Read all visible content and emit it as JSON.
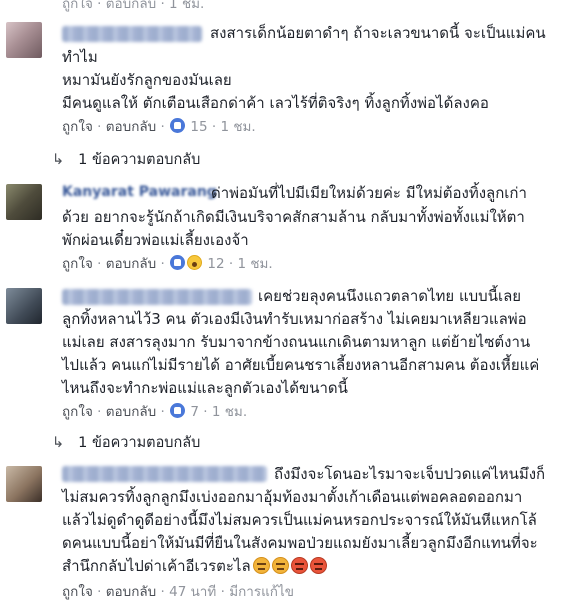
{
  "clipped_top": {
    "text": "ถูกใจ · ตอบกลับ · 1 ชม."
  },
  "comments": [
    {
      "text_lines": [
        "สงสารเด็กน้อยตาดำๆ ถ้าจะเลวขนาดนี้ จะเป็นแม่คน",
        "ทำไม",
        "หมามันยังรักลูกของมันเลย",
        "มีคนดูแลให้ ตักเตือนเสือกด่าค้า เลวไร้ที่ติจริงๆ ทิ้งลูกทิ้งพ่อได้ลงคอ"
      ],
      "like_label": "ถูกใจ",
      "reply_label": "ตอบกลับ",
      "reaction_count": "15",
      "time": "1 ชม.",
      "replies_label": "1 ข้อความตอบกลับ"
    },
    {
      "author": "Kanyarat Pawarang",
      "text_lines": [
        "ด่าพ่อมันที่ไปมีเมียใหม่ด้วยค่ะ มีใหม่ต้องทิ้งลูกเก่า",
        "ด้วย อยากจะรู้นักถ้าเกิดมีเงินบริจาคสักสามล้าน กลับมาทั้งพ่อทั้งแม่ให้ตา",
        "พักผ่อนเดี๋ยวพ่อแม่เลี้ยงเองจ้า"
      ],
      "like_label": "ถูกใจ",
      "reply_label": "ตอบกลับ",
      "reaction_count": "12",
      "time": "1 ชม."
    },
    {
      "text_lines": [
        "เคยช่วยลุงคนนึงแถวตลาดไทย แบบนี้เลย",
        "ลูกทิ้งหลานไว้3 คน ตัวเองมีเงินทำรับเหมาก่อสร้าง ไม่เคยมาเหลียวแลพ่อ",
        "แม่เลย สงสารลุงมาก รับมาจากข้างถนนแกเดินตามหาลูก แต่ย้ายไซต์งาน",
        "ไปแล้ว คนแก่ไม่มีรายได้ อาศัยเบี้ยคนชราเลี้ยงหลานอีกสามคน ต้องเหี้ยแค่",
        "ไหนถึงจะทำกะพ่อแม่และลูกตัวเองได้ขนาดนี้"
      ],
      "like_label": "ถูกใจ",
      "reply_label": "ตอบกลับ",
      "reaction_count": "7",
      "time": "1 ชม.",
      "replies_label": "1 ข้อความตอบกลับ"
    },
    {
      "text_lines": [
        "ถึงมึงจะโดนอะไรมาจะเจ็บปวดแค่ไหนมึงก็",
        "ไม่สมควรทิ้งลูกลูกมึงเบ่งออกมาอุ้มท้องมาตั้งเก้าเดือนแต่พอคลอดออกมา",
        "แล้วไม่ดูดำดูดีอย่างนี้มึงไม่สมควรเป็นแม่คนหรอกประจารณ์ให้มันหีแหกโล้",
        "ดคนแบบนี้อย่าให้มันมีที่ยืนในสังคมพอป่วยแถมยังมาเลี้ยวลูกมึงอีกแทนที่จะ",
        "สำนึกกลับไปด่าเค้าอีเวรตะไล"
      ],
      "like_label": "ถูกใจ",
      "reply_label": "ตอบกลับ",
      "time": "47 นาที",
      "edited_label": "มีการแก้ไข"
    }
  ],
  "colors": {
    "link": "#385898",
    "meta": "#90949c",
    "text": "#1d2129",
    "like_blue": "#4a78d9"
  }
}
